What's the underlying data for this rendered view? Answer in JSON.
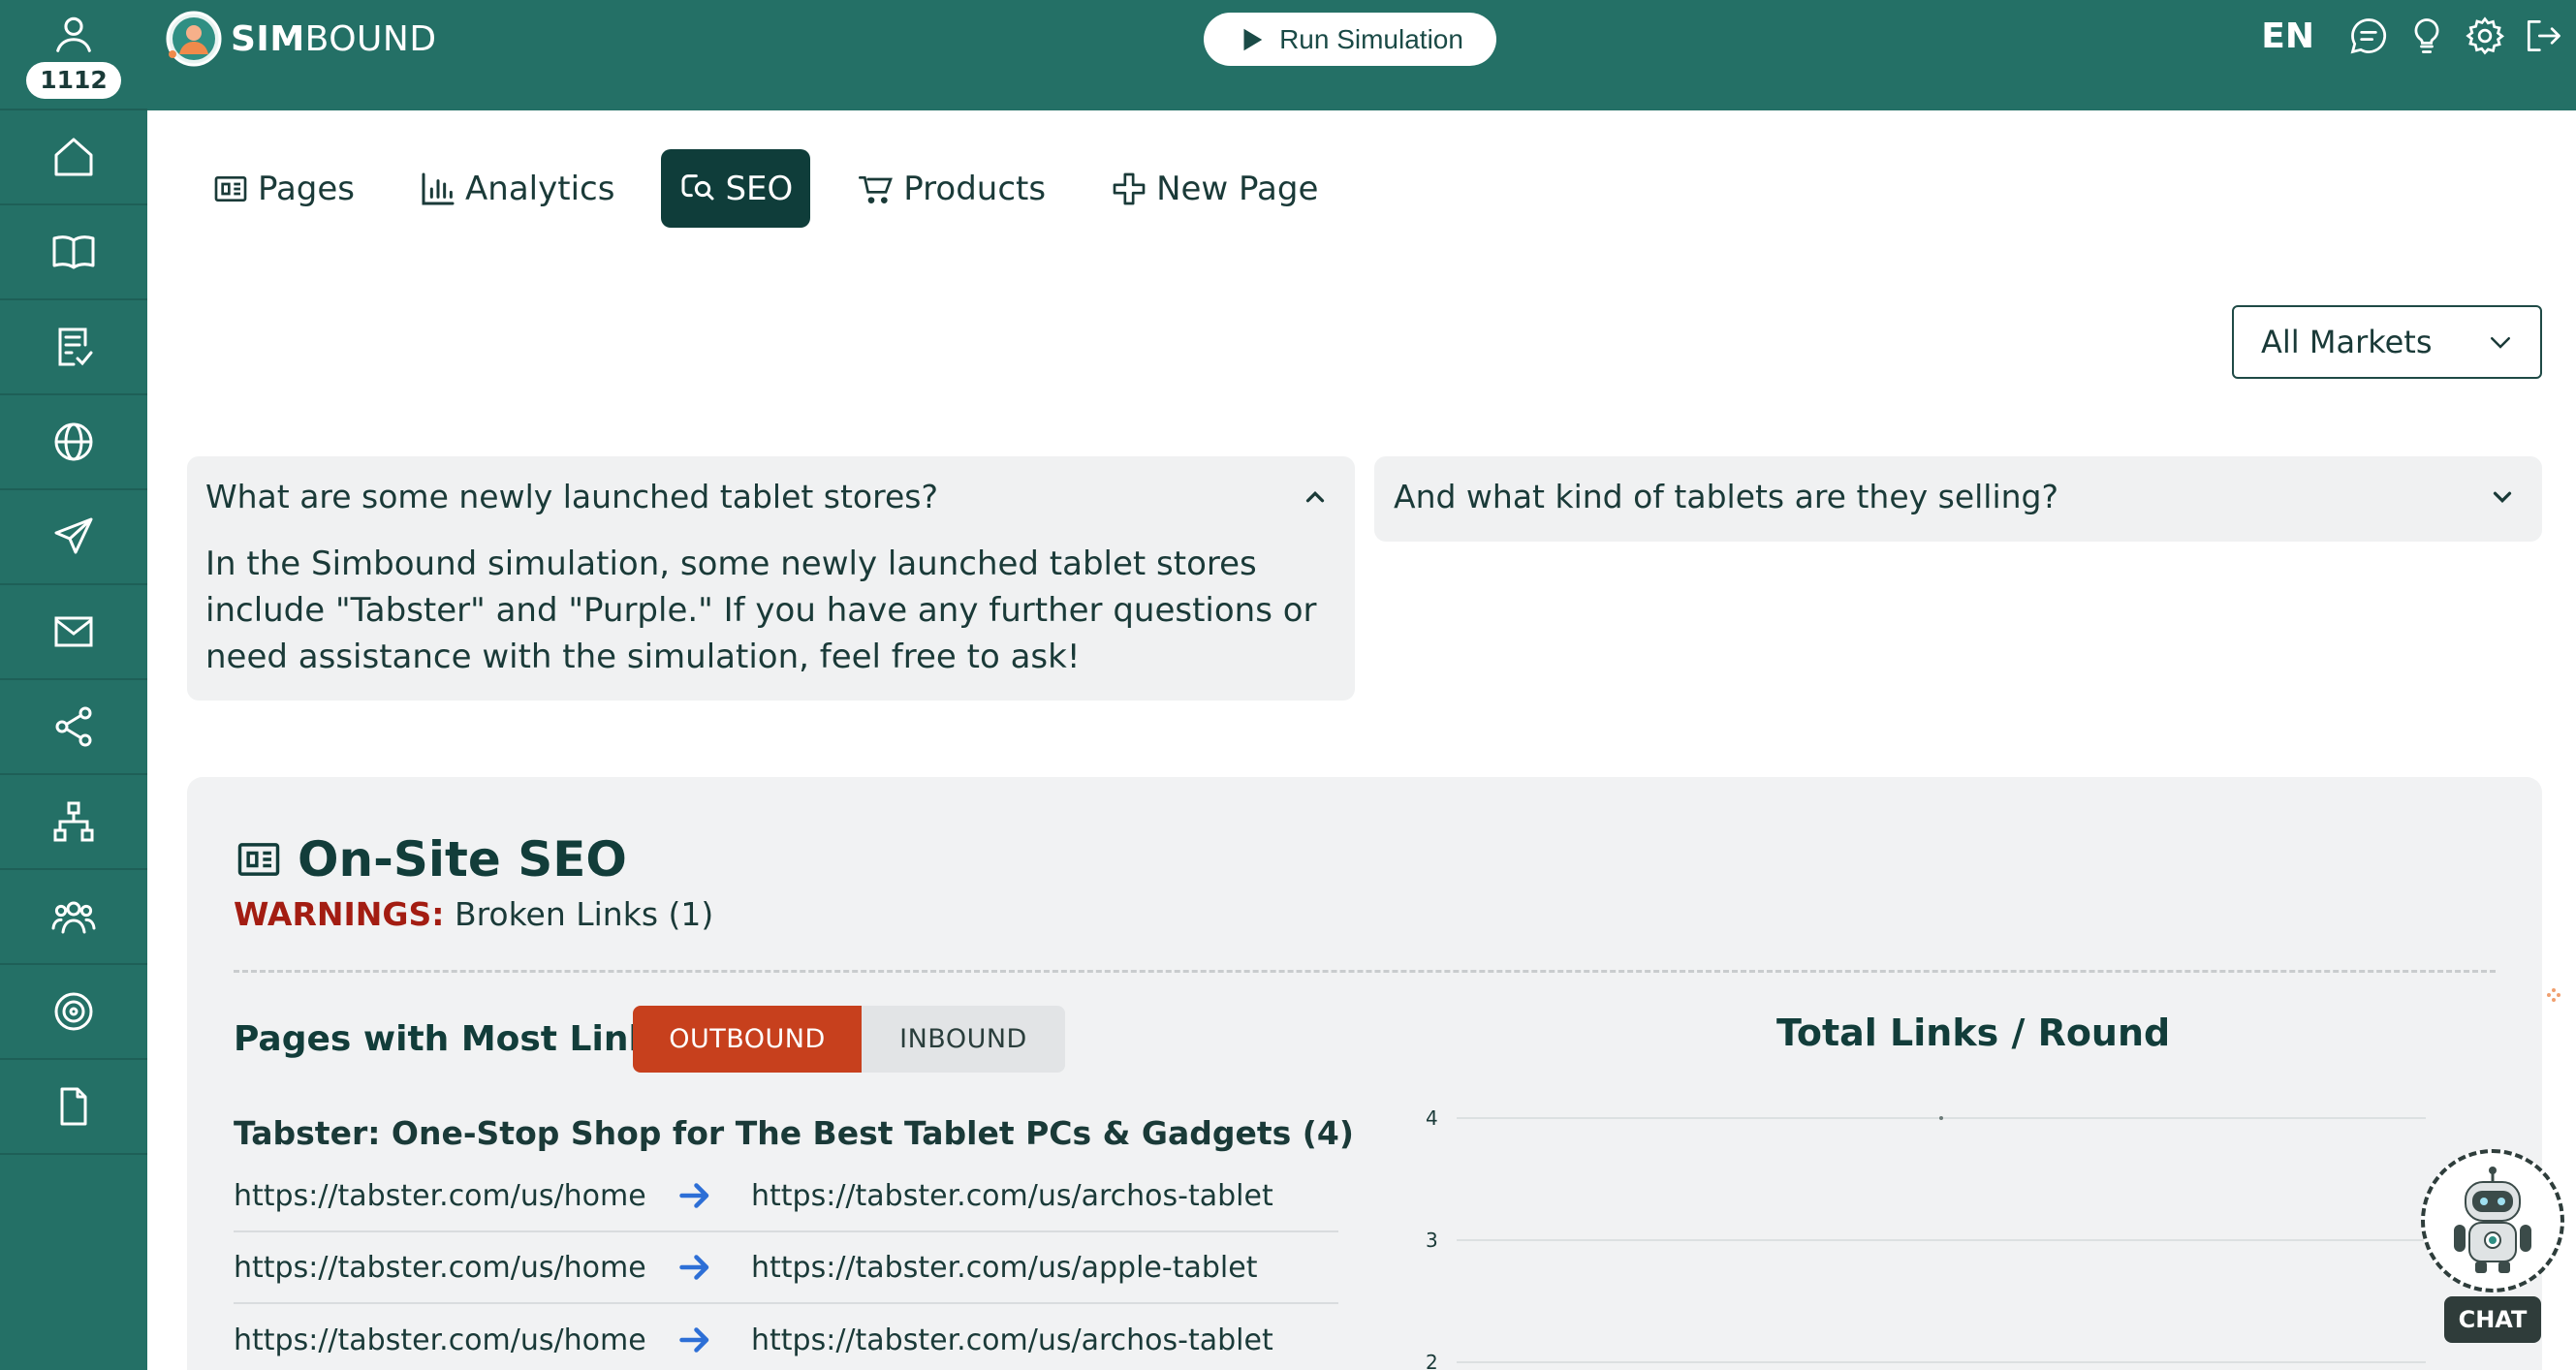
{
  "sidebar": {
    "user_count": "1112",
    "items": [
      "home-icon",
      "book-icon",
      "task-list-icon",
      "globe-icon",
      "send-icon",
      "mail-icon",
      "share-icon",
      "hierarchy-icon",
      "team-icon",
      "target-icon",
      "document-icon"
    ]
  },
  "topbar": {
    "brand_bold": "SIM",
    "brand_light": "BOUND",
    "run_label": "Run Simulation",
    "language": "EN"
  },
  "tabs": [
    {
      "label": "Pages",
      "icon": "pages-icon"
    },
    {
      "label": "Analytics",
      "icon": "analytics-icon"
    },
    {
      "label": "SEO",
      "icon": "seo-icon",
      "active": true
    },
    {
      "label": "Products",
      "icon": "cart-icon"
    },
    {
      "label": "New Page",
      "icon": "plus-icon"
    }
  ],
  "market_select": {
    "value": "All Markets"
  },
  "faq": [
    {
      "question": "What are some newly launched tablet stores?",
      "answer": "In the Simbound simulation, some newly launched tablet stores include \"Tabster\" and \"Purple.\" If you have any further questions or need assistance with the simulation, feel free to ask!",
      "expanded": true
    },
    {
      "question": "And what kind of tablets are they selling?",
      "expanded": false
    }
  ],
  "seo": {
    "title": "On-Site SEO",
    "warnings_label": "WARNINGS:",
    "warnings_text": "Broken Links (1)",
    "links_title": "Pages with Most Links",
    "toggle_outbound": "OUTBOUND",
    "toggle_inbound": "INBOUND",
    "group_title": "Tabster: One-Stop Shop for The Best Tablet PCs & Gadgets (4)",
    "links": [
      {
        "from": "https://tabster.com/us/home",
        "to": "https://tabster.com/us/archos-tablet"
      },
      {
        "from": "https://tabster.com/us/home",
        "to": "https://tabster.com/us/apple-tablet"
      },
      {
        "from": "https://tabster.com/us/home",
        "to": "https://tabster.com/us/archos-tablet"
      }
    ]
  },
  "chart_data": {
    "type": "line",
    "title": "Total Links / Round",
    "y_ticks": [
      "4",
      "3",
      "2"
    ],
    "ylim": [
      2,
      4
    ],
    "grid": true,
    "series": [
      {
        "values": [
          4
        ]
      }
    ]
  },
  "chat": {
    "label": "CHAT"
  },
  "colors": {
    "brand": "#247066",
    "active_tab": "#0f3d3a",
    "outbound": "#c7401d",
    "warning": "#a31d12",
    "arrow": "#2d6fd6"
  }
}
